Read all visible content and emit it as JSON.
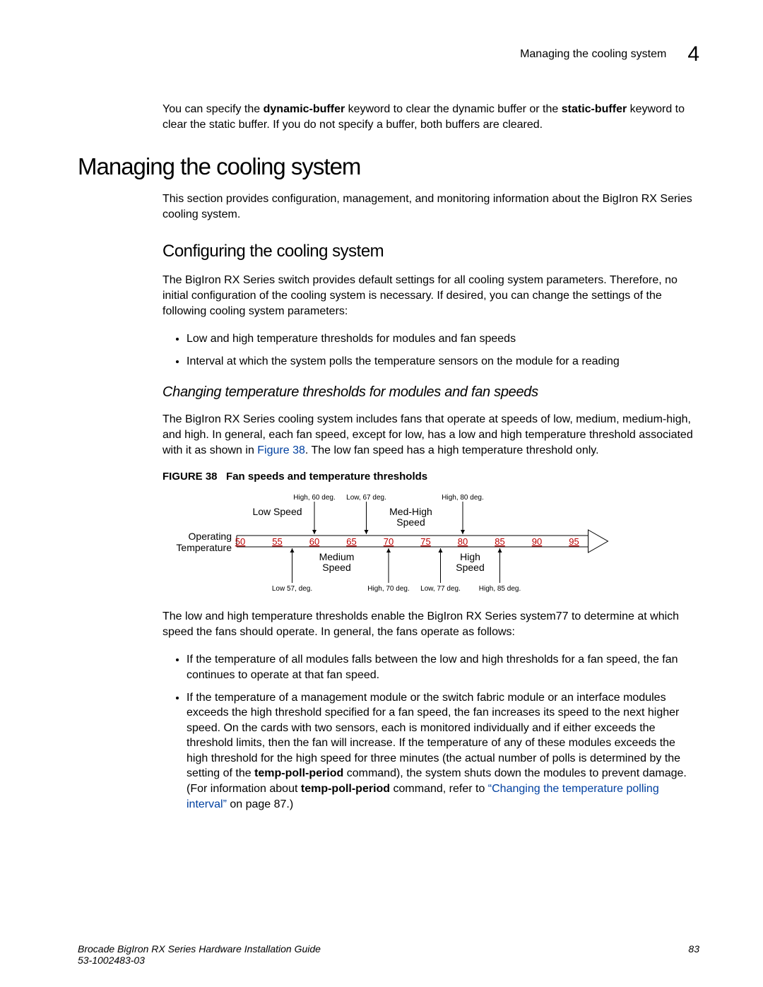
{
  "header": {
    "running": "Managing the cooling system",
    "chapter": "4"
  },
  "intro": {
    "pre": "You can specify the ",
    "kw1": "dynamic-buffer",
    "mid": " keyword to clear the dynamic buffer or the ",
    "kw2": "static-buffer",
    "post": " keyword to clear the static buffer. If you do not specify a buffer, both buffers are cleared."
  },
  "h1": "Managing the cooling system",
  "p1": "This section provides configuration, management, and monitoring information about the BigIron RX Series cooling system.",
  "h2": "Configuring the cooling system",
  "p2": "The BigIron RX Series switch provides default settings for all cooling system parameters. Therefore, no initial configuration of the cooling system is necessary. If desired, you can change the settings of the following cooling system parameters:",
  "bullets1": [
    "Low and high temperature thresholds for modules and fan speeds",
    "Interval at which the system polls the temperature sensors on the module for a reading"
  ],
  "h3": "Changing temperature thresholds for modules and fan speeds",
  "p3a": "The BigIron RX Series cooling system includes fans that operate at speeds of low, medium, medium-high, and high. In general, each fan speed, except for low, has a low and high temperature threshold associated with it as shown in ",
  "p3link": "Figure 38",
  "p3b": ". The low fan speed has a high temperature threshold only.",
  "figcap_label": "FIGURE 38",
  "figcap_text": "Fan speeds and temperature thresholds",
  "chart_data": {
    "type": "diagram",
    "axis_label": "Operating Temperature",
    "ticks": [
      50,
      55,
      60,
      65,
      70,
      75,
      80,
      85,
      90,
      95
    ],
    "speeds": [
      {
        "name": "Low Speed",
        "low": null,
        "high": 60
      },
      {
        "name": "Medium Speed",
        "low": 57,
        "high": 70
      },
      {
        "name": "Med-High Speed",
        "low": 67,
        "high": 80
      },
      {
        "name": "High Speed",
        "low": 77,
        "high": 85
      }
    ],
    "top_labels": [
      {
        "text": "High, 60 deg.",
        "x": 60
      },
      {
        "text": "Low, 67 deg.",
        "x": 67
      },
      {
        "text": "High, 80 deg.",
        "x": 80
      }
    ],
    "bottom_labels": [
      {
        "text": "Low 57, deg.",
        "x": 57
      },
      {
        "text": "High, 70 deg.",
        "x": 70
      },
      {
        "text": "Low, 77 deg.",
        "x": 77
      },
      {
        "text": "High, 85 deg.",
        "x": 85
      }
    ],
    "region_labels": [
      {
        "name": "Low Speed",
        "pos": "above",
        "x": 55
      },
      {
        "name": "Med-High",
        "name2": "Speed",
        "pos": "above",
        "x": 73
      },
      {
        "name": "Medium",
        "name2": "Speed",
        "pos": "below",
        "x": 63
      },
      {
        "name": "High",
        "name2": "Speed",
        "pos": "below",
        "x": 81
      }
    ]
  },
  "p4": "The low and high temperature thresholds enable the BigIron RX Series system77 to determine at which speed the fans should operate. In general, the fans operate as follows:",
  "bullets2": {
    "b1": "If the temperature of all modules falls between the low and high thresholds for a fan speed, the fan continues to operate at that fan speed.",
    "b2_pre": "If the temperature of a management module or the switch fabric module or an interface modules exceeds the high threshold specified for a fan speed, the fan increases its speed to the next higher speed. On the cards with two sensors, each is monitored individually and if either exceeds the threshold limits, then the fan will increase. If the temperature of any of these modules exceeds the high threshold for the high speed for three minutes (the actual number of polls is determined by the setting of the ",
    "b2_kw1": "temp-poll-period",
    "b2_mid1": " command), the system shuts down the modules to prevent damage. (For information about ",
    "b2_kw2": "temp-poll-period",
    "b2_mid2": " command, refer to ",
    "b2_link": "“Changing the temperature polling interval”",
    "b2_post": " on page 87.)"
  },
  "footer": {
    "left1": "Brocade BigIron RX Series Hardware Installation Guide",
    "left2": "53-1002483-03",
    "right": "83"
  }
}
